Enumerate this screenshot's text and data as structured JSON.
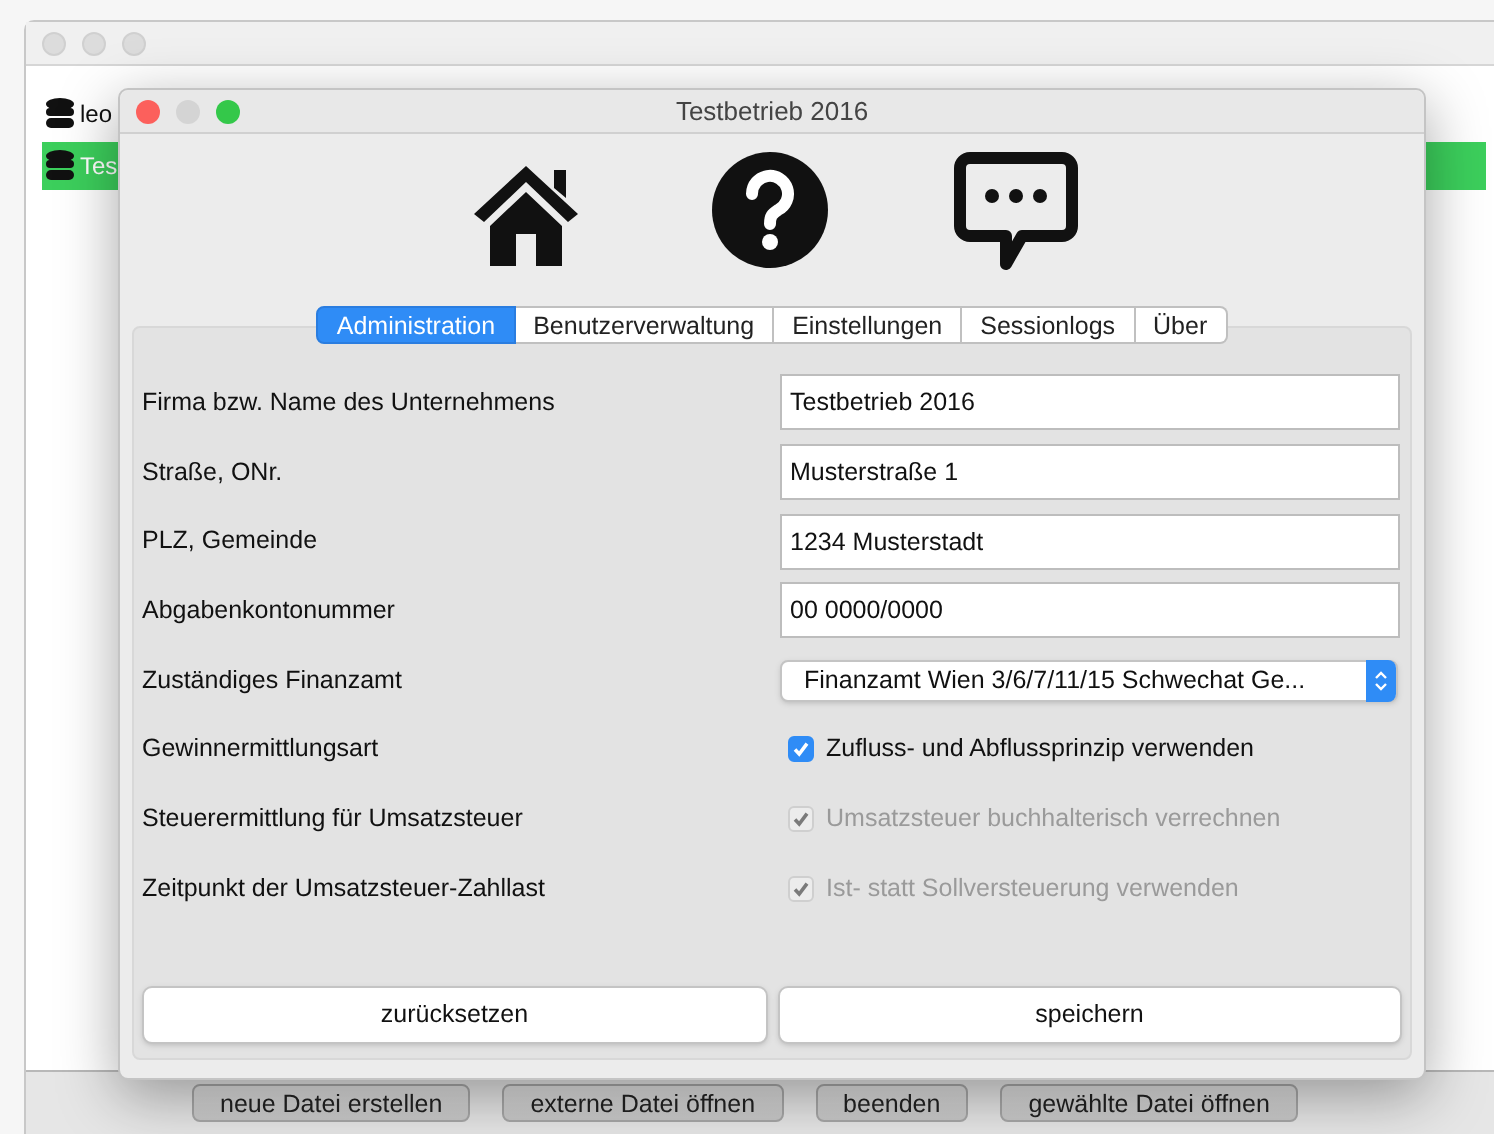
{
  "background_window": {
    "list_items": [
      {
        "label": "leo",
        "selected": false
      },
      {
        "label": "Tes",
        "selected": true
      }
    ],
    "buttons": [
      "neue Datei erstellen",
      "externe Datei öffnen",
      "beenden",
      "gewählte Datei öffnen"
    ]
  },
  "dialog": {
    "title": "Testbetrieb 2016",
    "tabs": [
      {
        "label": "Administration",
        "selected": true
      },
      {
        "label": "Benutzerverwaltung",
        "selected": false
      },
      {
        "label": "Einstellungen",
        "selected": false
      },
      {
        "label": "Sessionlogs",
        "selected": false
      },
      {
        "label": "Über",
        "selected": false
      }
    ],
    "rows": [
      {
        "kind": "text",
        "label": "Firma bzw. Name des Unternehmens",
        "value": "Testbetrieb 2016"
      },
      {
        "kind": "text",
        "label": "Straße, ONr.",
        "value": "Musterstraße 1"
      },
      {
        "kind": "text",
        "label": "PLZ, Gemeinde",
        "value": "1234 Musterstadt"
      },
      {
        "kind": "text",
        "label": "Abgabenkontonummer",
        "value": "00 0000/0000"
      },
      {
        "kind": "select",
        "label": "Zuständiges Finanzamt",
        "value": "Finanzamt Wien 3/6/7/11/15 Schwechat Ge..."
      },
      {
        "kind": "checkbox",
        "label": "Gewinnermittlungsart",
        "value": "Zufluss- und Abflussprinzip verwenden",
        "checked": true,
        "disabled": false
      },
      {
        "kind": "checkbox",
        "label": "Steuerermittlung für Umsatzsteuer",
        "value": "Umsatzsteuer buchhalterisch verrechnen",
        "checked": true,
        "disabled": true
      },
      {
        "kind": "checkbox",
        "label": "Zeitpunkt der Umsatzsteuer-Zahllast",
        "value": "Ist- statt Sollversteuerung verwenden",
        "checked": true,
        "disabled": true
      }
    ],
    "buttons": [
      "zurücksetzen",
      "speichern"
    ]
  }
}
